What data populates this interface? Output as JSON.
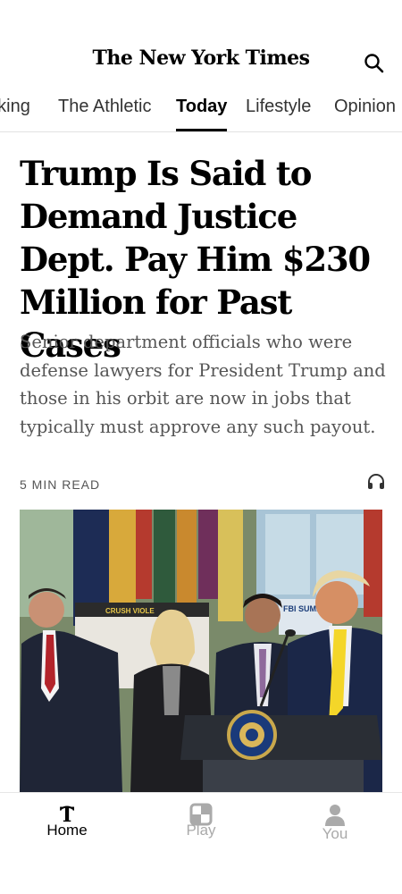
{
  "header": {
    "masthead": "The New York Times",
    "search_icon": "search-icon"
  },
  "sections": {
    "items": [
      {
        "label": "oking"
      },
      {
        "label": "The Athletic"
      },
      {
        "label": "Today"
      },
      {
        "label": "Lifestyle"
      },
      {
        "label": "Opinion"
      }
    ],
    "active": "Today"
  },
  "article": {
    "headline": "Trump Is Said to Demand Justice Dept. Pay Him $230 Million for Past Cases",
    "summary": "Senior department officials who were defense lawyers for President Trump and those in his orbit are now in jobs that typically must approve any such payout.",
    "read_time": "5 MIN READ",
    "listen_icon": "headphones-icon",
    "photo": {
      "sign_text": "CRUSH VIOLE",
      "banner_text": "FBI SUMM"
    }
  },
  "bottom_nav": {
    "items": [
      {
        "label": "Home",
        "icon": "nyt-t-icon",
        "active": true
      },
      {
        "label": "Play",
        "icon": "play-grid-icon",
        "active": false
      },
      {
        "label": "You",
        "icon": "person-icon",
        "active": false
      }
    ]
  },
  "colors": {
    "text": "#121212",
    "muted": "#555555",
    "nav_inactive": "#aaaaaa",
    "divider": "#e2e2e2"
  }
}
